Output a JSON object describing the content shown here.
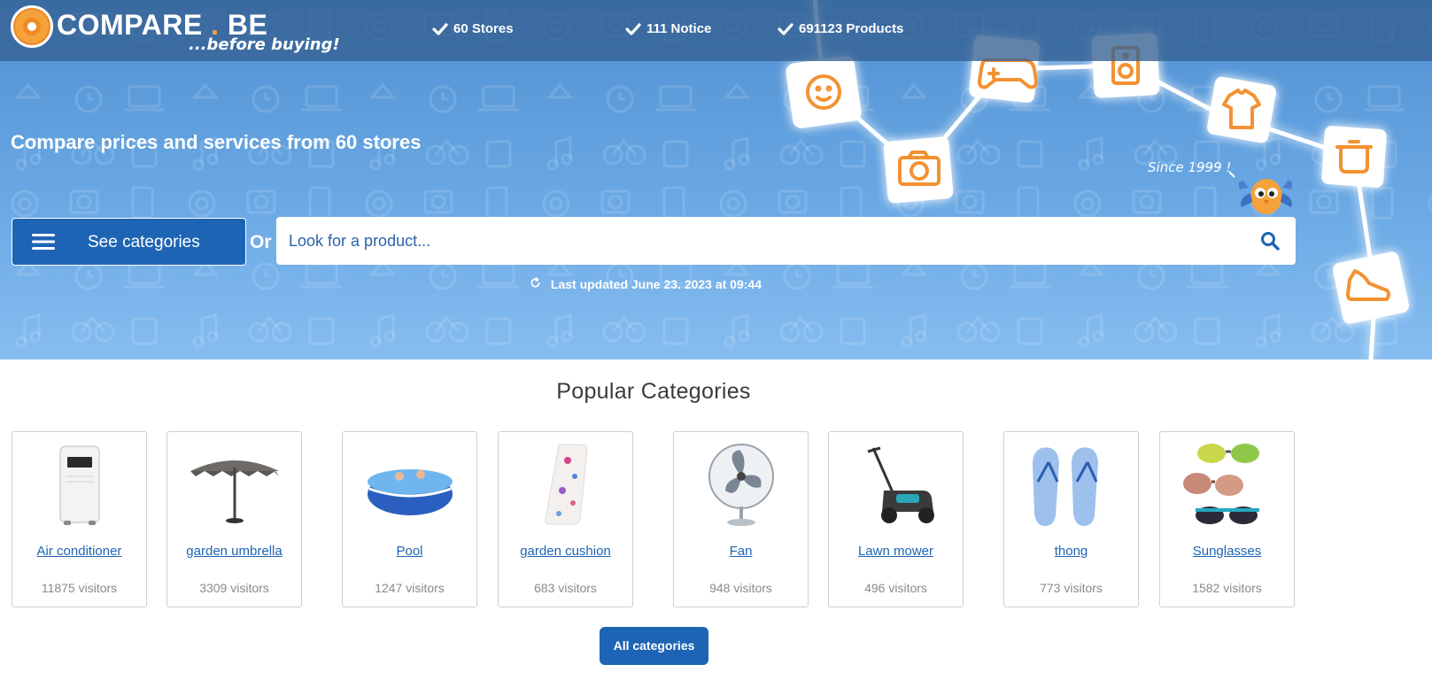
{
  "brand": {
    "name_part1": "COMPARE",
    "name_dot": ".",
    "name_part2": "BE",
    "tagline": "...before buying!"
  },
  "stats": [
    {
      "label": "60 Stores"
    },
    {
      "label": "111 Notice"
    },
    {
      "label": "691123 Products"
    }
  ],
  "hero": {
    "title": "Compare prices and services from 60 stores",
    "see_categories": "See categories",
    "or": "Or",
    "search_placeholder": "Look for a product...",
    "last_updated": "Last updated June 23. 2023 at 09:44",
    "since": "Since 1999 !"
  },
  "popular": {
    "title": "Popular Categories",
    "items": [
      {
        "name": "Air conditioner",
        "visitors": "11875 visitors",
        "icon": "air-conditioner-image"
      },
      {
        "name": "garden umbrella",
        "visitors": "3309 visitors",
        "icon": "umbrella-image"
      },
      {
        "name": "Pool",
        "visitors": "1247 visitors",
        "icon": "pool-image"
      },
      {
        "name": "garden cushion",
        "visitors": "683 visitors",
        "icon": "cushion-image"
      },
      {
        "name": "Fan",
        "visitors": "948 visitors",
        "icon": "fan-image"
      },
      {
        "name": "Lawn mower",
        "visitors": "496 visitors",
        "icon": "lawn-mower-image"
      },
      {
        "name": "thong",
        "visitors": "773 visitors",
        "icon": "flip-flops-image"
      },
      {
        "name": "Sunglasses",
        "visitors": "1582 visitors",
        "icon": "sunglasses-image"
      }
    ],
    "all_button": "All categories"
  },
  "colors": {
    "primary": "#1e64b4",
    "accent": "#f5a23a",
    "hero_top": "#4f90d2",
    "hero_bottom": "#86bdf0"
  }
}
